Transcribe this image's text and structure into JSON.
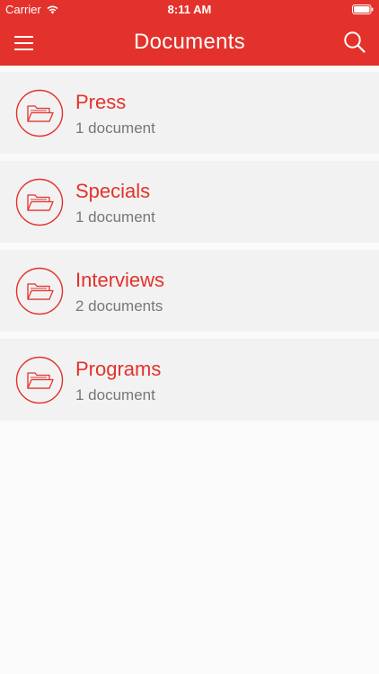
{
  "status": {
    "carrier": "Carrier",
    "time": "8:11 AM"
  },
  "header": {
    "title": "Documents",
    "menu_icon": "hamburger-menu-icon",
    "search_icon": "search-icon"
  },
  "colors": {
    "brand": "#e3322b",
    "row_background": "#f2f2f2",
    "subtitle": "#777777",
    "page_background": "#fafafa"
  },
  "folders": [
    {
      "name": "Press",
      "count": "1 document",
      "icon": "folder-icon"
    },
    {
      "name": "Specials",
      "count": "1 document",
      "icon": "folder-icon"
    },
    {
      "name": "Interviews",
      "count": "2 documents",
      "icon": "folder-icon"
    },
    {
      "name": "Programs",
      "count": "1 document",
      "icon": "folder-icon"
    }
  ]
}
